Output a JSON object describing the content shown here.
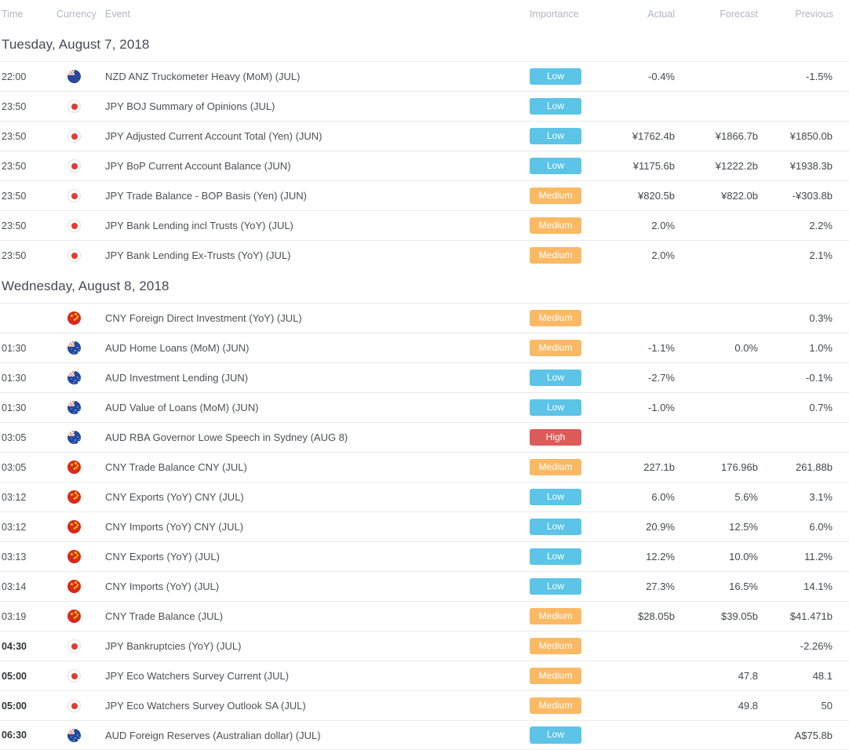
{
  "columns": {
    "time": "Time",
    "currency": "Currency",
    "event": "Event",
    "importance": "Importance",
    "actual": "Actual",
    "forecast": "Forecast",
    "previous": "Previous"
  },
  "colors": {
    "low_badge": "#5bc4e7",
    "medium_badge": "#fbb964",
    "high_badge": "#dd5b58",
    "value_negative": "#f4606f",
    "value_positive": "#45a0ef",
    "text": "#44474d",
    "header_text": "#b0b6c2",
    "row_border": "#e9eaec"
  },
  "sections": [
    {
      "date": "Tuesday, August 7, 2018",
      "rows": [
        {
          "time": "22:00",
          "time_bold": false,
          "flag": "nzd",
          "flag_name": "flag-icon-new-zealand",
          "event": "NZD ANZ Truckometer Heavy (MoM) (JUL)",
          "importance": "Low",
          "importance_level": "low",
          "actual": "-0.4%",
          "actual_color": "default",
          "forecast": "",
          "forecast_color": "default",
          "previous": "-1.5%",
          "previous_color": "default"
        },
        {
          "time": "23:50",
          "time_bold": false,
          "flag": "jpy",
          "flag_name": "flag-icon-japan",
          "event": "JPY BOJ Summary of Opinions (JUL)",
          "importance": "Low",
          "importance_level": "low",
          "actual": "",
          "actual_color": "default",
          "forecast": "",
          "forecast_color": "default",
          "previous": "",
          "previous_color": "default"
        },
        {
          "time": "23:50",
          "time_bold": false,
          "flag": "jpy",
          "flag_name": "flag-icon-japan",
          "event": "JPY Adjusted Current Account Total (Yen) (JUN)",
          "importance": "Low",
          "importance_level": "low",
          "actual": "¥1762.4b",
          "actual_color": "red",
          "forecast": "¥1866.7b",
          "forecast_color": "default",
          "previous": "¥1850.0b",
          "previous_color": "default"
        },
        {
          "time": "23:50",
          "time_bold": false,
          "flag": "jpy",
          "flag_name": "flag-icon-japan",
          "event": "JPY BoP Current Account Balance (JUN)",
          "importance": "Low",
          "importance_level": "low",
          "actual": "¥1175.6b",
          "actual_color": "red",
          "forecast": "¥1222.2b",
          "forecast_color": "default",
          "previous": "¥1938.3b",
          "previous_color": "default"
        },
        {
          "time": "23:50",
          "time_bold": false,
          "flag": "jpy",
          "flag_name": "flag-icon-japan",
          "event": "JPY Trade Balance - BOP Basis (Yen) (JUN)",
          "importance": "Medium",
          "importance_level": "medium",
          "actual": "¥820.5b",
          "actual_color": "red",
          "forecast": "¥822.0b",
          "forecast_color": "default",
          "previous": "-¥303.8b",
          "previous_color": "default"
        },
        {
          "time": "23:50",
          "time_bold": false,
          "flag": "jpy",
          "flag_name": "flag-icon-japan",
          "event": "JPY Bank Lending incl Trusts (YoY) (JUL)",
          "importance": "Medium",
          "importance_level": "medium",
          "actual": "2.0%",
          "actual_color": "default",
          "forecast": "",
          "forecast_color": "default",
          "previous": "2.2%",
          "previous_color": "default"
        },
        {
          "time": "23:50",
          "time_bold": false,
          "flag": "jpy",
          "flag_name": "flag-icon-japan",
          "event": "JPY Bank Lending Ex-Trusts (YoY) (JUL)",
          "importance": "Medium",
          "importance_level": "medium",
          "actual": "2.0%",
          "actual_color": "default",
          "forecast": "",
          "forecast_color": "default",
          "previous": "2.1%",
          "previous_color": "default"
        }
      ]
    },
    {
      "date": "Wednesday, August 8, 2018",
      "rows": [
        {
          "time": "",
          "time_bold": false,
          "flag": "cny",
          "flag_name": "flag-icon-china",
          "event": "CNY Foreign Direct Investment (YoY) (JUL)",
          "importance": "Medium",
          "importance_level": "medium",
          "actual": "",
          "actual_color": "default",
          "forecast": "",
          "forecast_color": "default",
          "previous": "0.3%",
          "previous_color": "default"
        },
        {
          "time": "01:30",
          "time_bold": false,
          "flag": "aud",
          "flag_name": "flag-icon-australia",
          "event": "AUD Home Loans (MoM) (JUN)",
          "importance": "Medium",
          "importance_level": "medium",
          "actual": "-1.1%",
          "actual_color": "red",
          "forecast": "0.0%",
          "forecast_color": "default",
          "previous": "1.0%",
          "previous_color": "red"
        },
        {
          "time": "01:30",
          "time_bold": false,
          "flag": "aud",
          "flag_name": "flag-icon-australia",
          "event": "AUD Investment Lending (JUN)",
          "importance": "Low",
          "importance_level": "low",
          "actual": "-2.7%",
          "actual_color": "default",
          "forecast": "",
          "forecast_color": "default",
          "previous": "-0.1%",
          "previous_color": "default"
        },
        {
          "time": "01:30",
          "time_bold": false,
          "flag": "aud",
          "flag_name": "flag-icon-australia",
          "event": "AUD Value of Loans (MoM) (JUN)",
          "importance": "Low",
          "importance_level": "low",
          "actual": "-1.0%",
          "actual_color": "default",
          "forecast": "",
          "forecast_color": "default",
          "previous": "0.7%",
          "previous_color": "default"
        },
        {
          "time": "03:05",
          "time_bold": false,
          "flag": "aud",
          "flag_name": "flag-icon-australia",
          "event": "AUD RBA Governor Lowe Speech in Sydney (AUG 8)",
          "importance": "High",
          "importance_level": "high",
          "actual": "",
          "actual_color": "default",
          "forecast": "",
          "forecast_color": "default",
          "previous": "",
          "previous_color": "default"
        },
        {
          "time": "03:05",
          "time_bold": false,
          "flag": "cny",
          "flag_name": "flag-icon-china",
          "event": "CNY Trade Balance CNY (JUL)",
          "importance": "Medium",
          "importance_level": "medium",
          "actual": "227.1b",
          "actual_color": "blue",
          "forecast": "176.96b",
          "forecast_color": "default",
          "previous": "261.88b",
          "previous_color": "default"
        },
        {
          "time": "03:12",
          "time_bold": false,
          "flag": "cny",
          "flag_name": "flag-icon-china",
          "event": "CNY Exports (YoY) CNY (JUL)",
          "importance": "Low",
          "importance_level": "low",
          "actual": "6.0%",
          "actual_color": "blue",
          "forecast": "5.6%",
          "forecast_color": "default",
          "previous": "3.1%",
          "previous_color": "default"
        },
        {
          "time": "03:12",
          "time_bold": false,
          "flag": "cny",
          "flag_name": "flag-icon-china",
          "event": "CNY Imports (YoY) CNY (JUL)",
          "importance": "Low",
          "importance_level": "low",
          "actual": "20.9%",
          "actual_color": "blue",
          "forecast": "12.5%",
          "forecast_color": "default",
          "previous": "6.0%",
          "previous_color": "default"
        },
        {
          "time": "03:13",
          "time_bold": false,
          "flag": "cny",
          "flag_name": "flag-icon-china",
          "event": "CNY Exports (YoY) (JUL)",
          "importance": "Low",
          "importance_level": "low",
          "actual": "12.2%",
          "actual_color": "blue",
          "forecast": "10.0%",
          "forecast_color": "default",
          "previous": "11.2%",
          "previous_color": "default"
        },
        {
          "time": "03:14",
          "time_bold": false,
          "flag": "cny",
          "flag_name": "flag-icon-china",
          "event": "CNY Imports (YoY) (JUL)",
          "importance": "Low",
          "importance_level": "low",
          "actual": "27.3%",
          "actual_color": "blue",
          "forecast": "16.5%",
          "forecast_color": "default",
          "previous": "14.1%",
          "previous_color": "default"
        },
        {
          "time": "03:19",
          "time_bold": false,
          "flag": "cny",
          "flag_name": "flag-icon-china",
          "event": "CNY Trade Balance (JUL)",
          "importance": "Medium",
          "importance_level": "medium",
          "actual": "$28.05b",
          "actual_color": "red",
          "forecast": "$39.05b",
          "forecast_color": "default",
          "previous": "$41.471b",
          "previous_color": "blue"
        },
        {
          "time": "04:30",
          "time_bold": true,
          "flag": "jpy",
          "flag_name": "flag-icon-japan",
          "event": "JPY Bankruptcies (YoY) (JUL)",
          "importance": "Medium",
          "importance_level": "medium",
          "actual": "",
          "actual_color": "default",
          "forecast": "",
          "forecast_color": "default",
          "previous": "-2.26%",
          "previous_color": "default"
        },
        {
          "time": "05:00",
          "time_bold": true,
          "flag": "jpy",
          "flag_name": "flag-icon-japan",
          "event": "JPY Eco Watchers Survey Current (JUL)",
          "importance": "Medium",
          "importance_level": "medium",
          "actual": "",
          "actual_color": "default",
          "forecast": "47.8",
          "forecast_color": "default",
          "previous": "48.1",
          "previous_color": "default"
        },
        {
          "time": "05:00",
          "time_bold": true,
          "flag": "jpy",
          "flag_name": "flag-icon-japan",
          "event": "JPY Eco Watchers Survey Outlook SA (JUL)",
          "importance": "Medium",
          "importance_level": "medium",
          "actual": "",
          "actual_color": "default",
          "forecast": "49.8",
          "forecast_color": "default",
          "previous": "50",
          "previous_color": "default"
        },
        {
          "time": "06:30",
          "time_bold": true,
          "flag": "aud",
          "flag_name": "flag-icon-australia",
          "event": "AUD Foreign Reserves (Australian dollar) (JUL)",
          "importance": "Low",
          "importance_level": "low",
          "actual": "",
          "actual_color": "default",
          "forecast": "",
          "forecast_color": "default",
          "previous": "A$75.8b",
          "previous_color": "default"
        }
      ]
    }
  ]
}
